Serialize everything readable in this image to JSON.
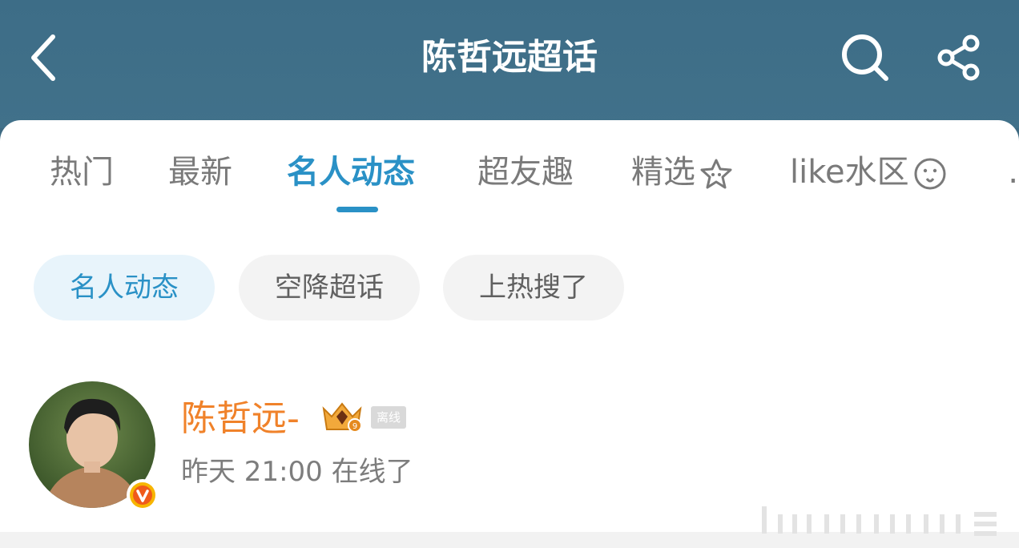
{
  "header": {
    "title": "陈哲远超话",
    "back_icon": "back-arrow-icon",
    "search_icon": "search-icon",
    "share_icon": "share-icon",
    "background_color": "#3e6a82"
  },
  "tabs": [
    {
      "label": "热门",
      "active": false
    },
    {
      "label": "最新",
      "active": false
    },
    {
      "label": "名人动态",
      "active": true
    },
    {
      "label": "超友趣",
      "active": false
    },
    {
      "label": "精选",
      "active": false,
      "icon": "star-face-icon"
    },
    {
      "label": "like水区",
      "active": false,
      "icon": "smile-face-icon"
    }
  ],
  "chips": [
    {
      "label": "名人动态",
      "active": true
    },
    {
      "label": "空降超话",
      "active": false
    },
    {
      "label": "上热搜了",
      "active": false
    }
  ],
  "user": {
    "name": "陈哲远-",
    "rank_icon": "crown-level-badge-icon",
    "status_badge": "离线",
    "last_online": "昨天 21:00 在线了",
    "verified_icon": "verified-v-icon"
  },
  "colors": {
    "accent": "#2a91c6",
    "username": "#f0822a",
    "tab_inactive": "#7a7a7a"
  }
}
